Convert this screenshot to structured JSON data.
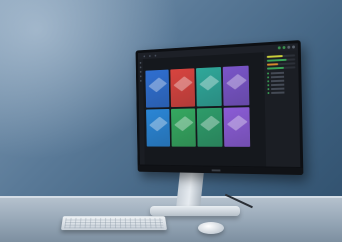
{
  "scene": {
    "colors": {
      "wall": "#4d6f8d",
      "desk": "#a3b2c0",
      "monitor_bezel": "#0d0f13"
    }
  },
  "screen": {
    "topbar": {
      "logo": "",
      "items": [
        "",
        "",
        ""
      ]
    },
    "tiles": [
      {
        "label": "",
        "color": "#2f6fd1",
        "icon": "cube-icon"
      },
      {
        "label": "",
        "color": "#d8443f",
        "icon": "cube-icon"
      },
      {
        "label": "",
        "color": "#2fa89a",
        "icon": "cube-icon"
      },
      {
        "label": "",
        "color": "#7a55c9",
        "icon": "cube-icon"
      },
      {
        "label": "",
        "color": "#2a86d6",
        "icon": "cube-icon"
      },
      {
        "label": "",
        "color": "#35a860",
        "icon": "cube-icon"
      },
      {
        "label": "",
        "color": "#2e9c6a",
        "icon": "cube-icon"
      },
      {
        "label": "",
        "color": "#8b5cd6",
        "icon": "cube-icon"
      }
    ],
    "panel": {
      "bars": [
        {
          "level": 0.55,
          "color": "#c9ce3a"
        },
        {
          "level": 0.7,
          "color": "#3aa356"
        },
        {
          "level": 0.4,
          "color": "#d48a2c"
        },
        {
          "level": 0.6,
          "color": "#3aa356"
        }
      ],
      "list_dots": [
        "#3aa356",
        "#3aa356",
        "#3aa356",
        "#3aa356",
        "#3aa356",
        "#3aa356"
      ]
    }
  }
}
